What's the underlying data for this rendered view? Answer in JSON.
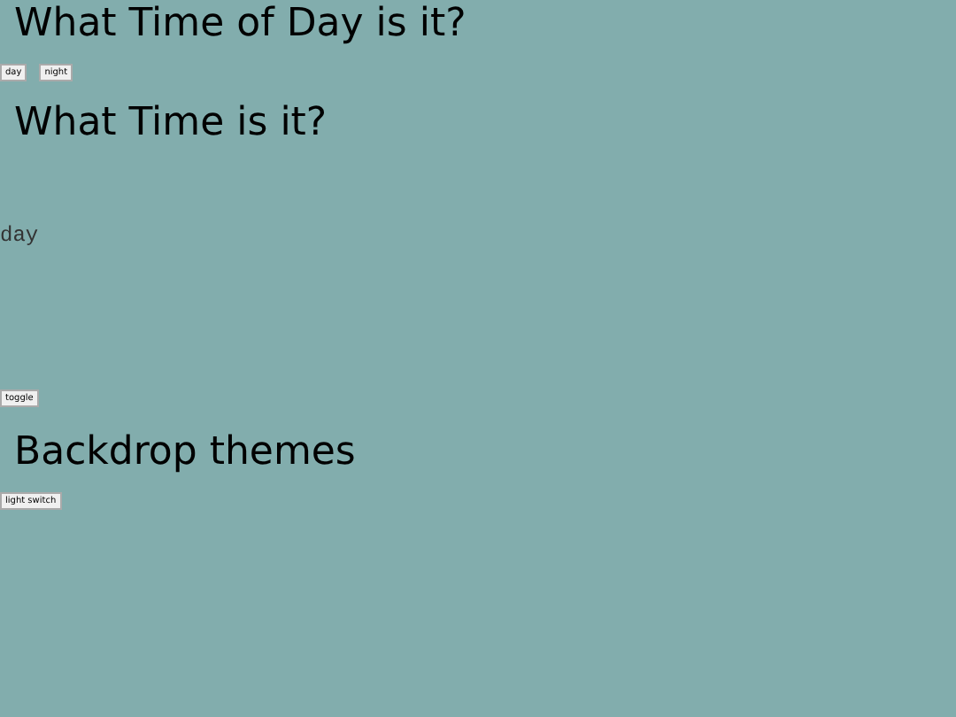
{
  "sections": [
    {
      "heading": "What Time of Day is it?",
      "buttons": [
        "day",
        "night"
      ]
    },
    {
      "heading": "What Time is it?",
      "readout": "day",
      "buttons": [
        "toggle"
      ]
    },
    {
      "heading": "Backdrop themes",
      "buttons": [
        "light switch"
      ]
    }
  ]
}
